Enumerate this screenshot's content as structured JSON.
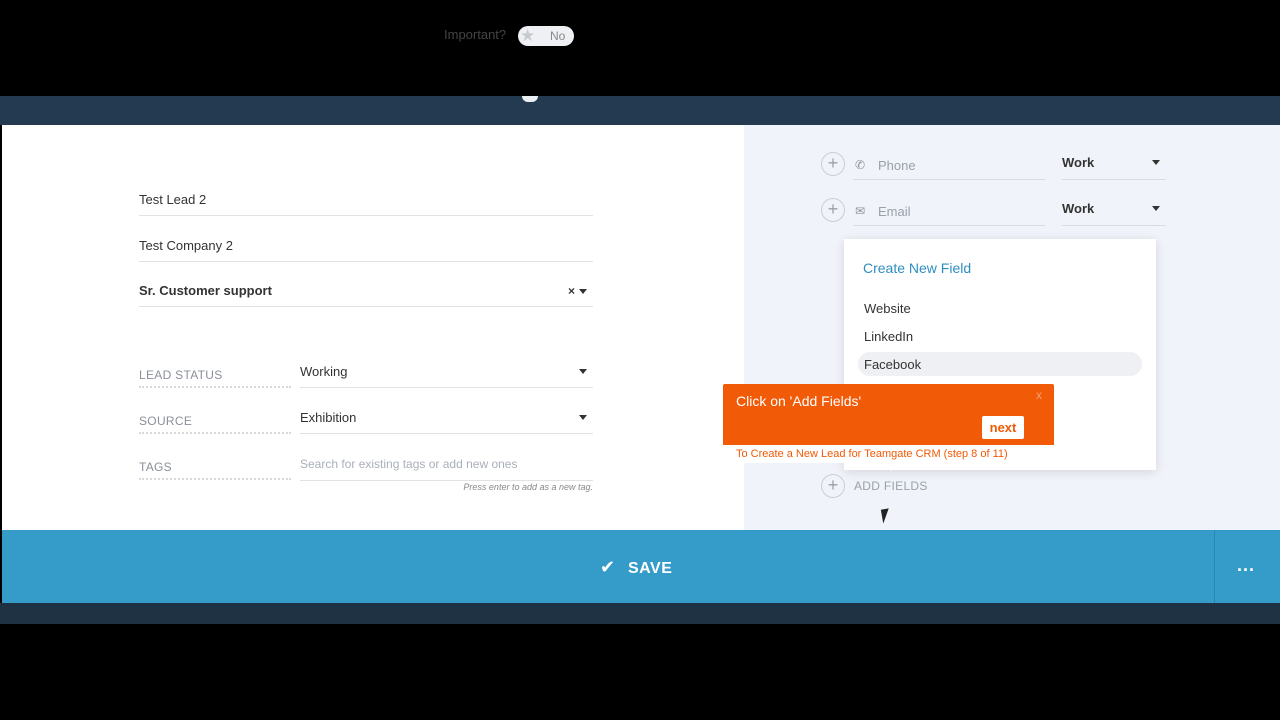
{
  "important": {
    "label": "Important?",
    "toggle_value": "No"
  },
  "form": {
    "name": "Test Lead 2",
    "company": "Test Company 2",
    "title": "Sr. Customer support",
    "clear_symbol": "×"
  },
  "details": [
    {
      "label": "LEAD STATUS",
      "value": "Working"
    },
    {
      "label": "SOURCE",
      "value": "Exhibition"
    },
    {
      "label": "TAGS",
      "placeholder": "Search for existing tags or add new ones"
    }
  ],
  "tags_hint": "Press enter to add as a new tag.",
  "contact": {
    "phone": {
      "placeholder": "Phone",
      "type": "Work"
    },
    "email": {
      "placeholder": "Email",
      "type": "Work"
    }
  },
  "dropdown": {
    "title": "Create New Field",
    "options": [
      "Website",
      "LinkedIn",
      "Facebook"
    ],
    "highlighted": "Facebook"
  },
  "add_fields_label": "ADD FIELDS",
  "tour": {
    "message": "Click on 'Add Fields'",
    "close": "x",
    "next_label": "next",
    "footer": "To Create a New Lead for Teamgate CRM (step 8 of 11)"
  },
  "savebar": {
    "save_label": "SAVE",
    "more_label": "..."
  },
  "colors": {
    "accent": "#359bc9",
    "tour": "#f15a07",
    "link": "#2f8ec0",
    "header": "#243a51"
  }
}
